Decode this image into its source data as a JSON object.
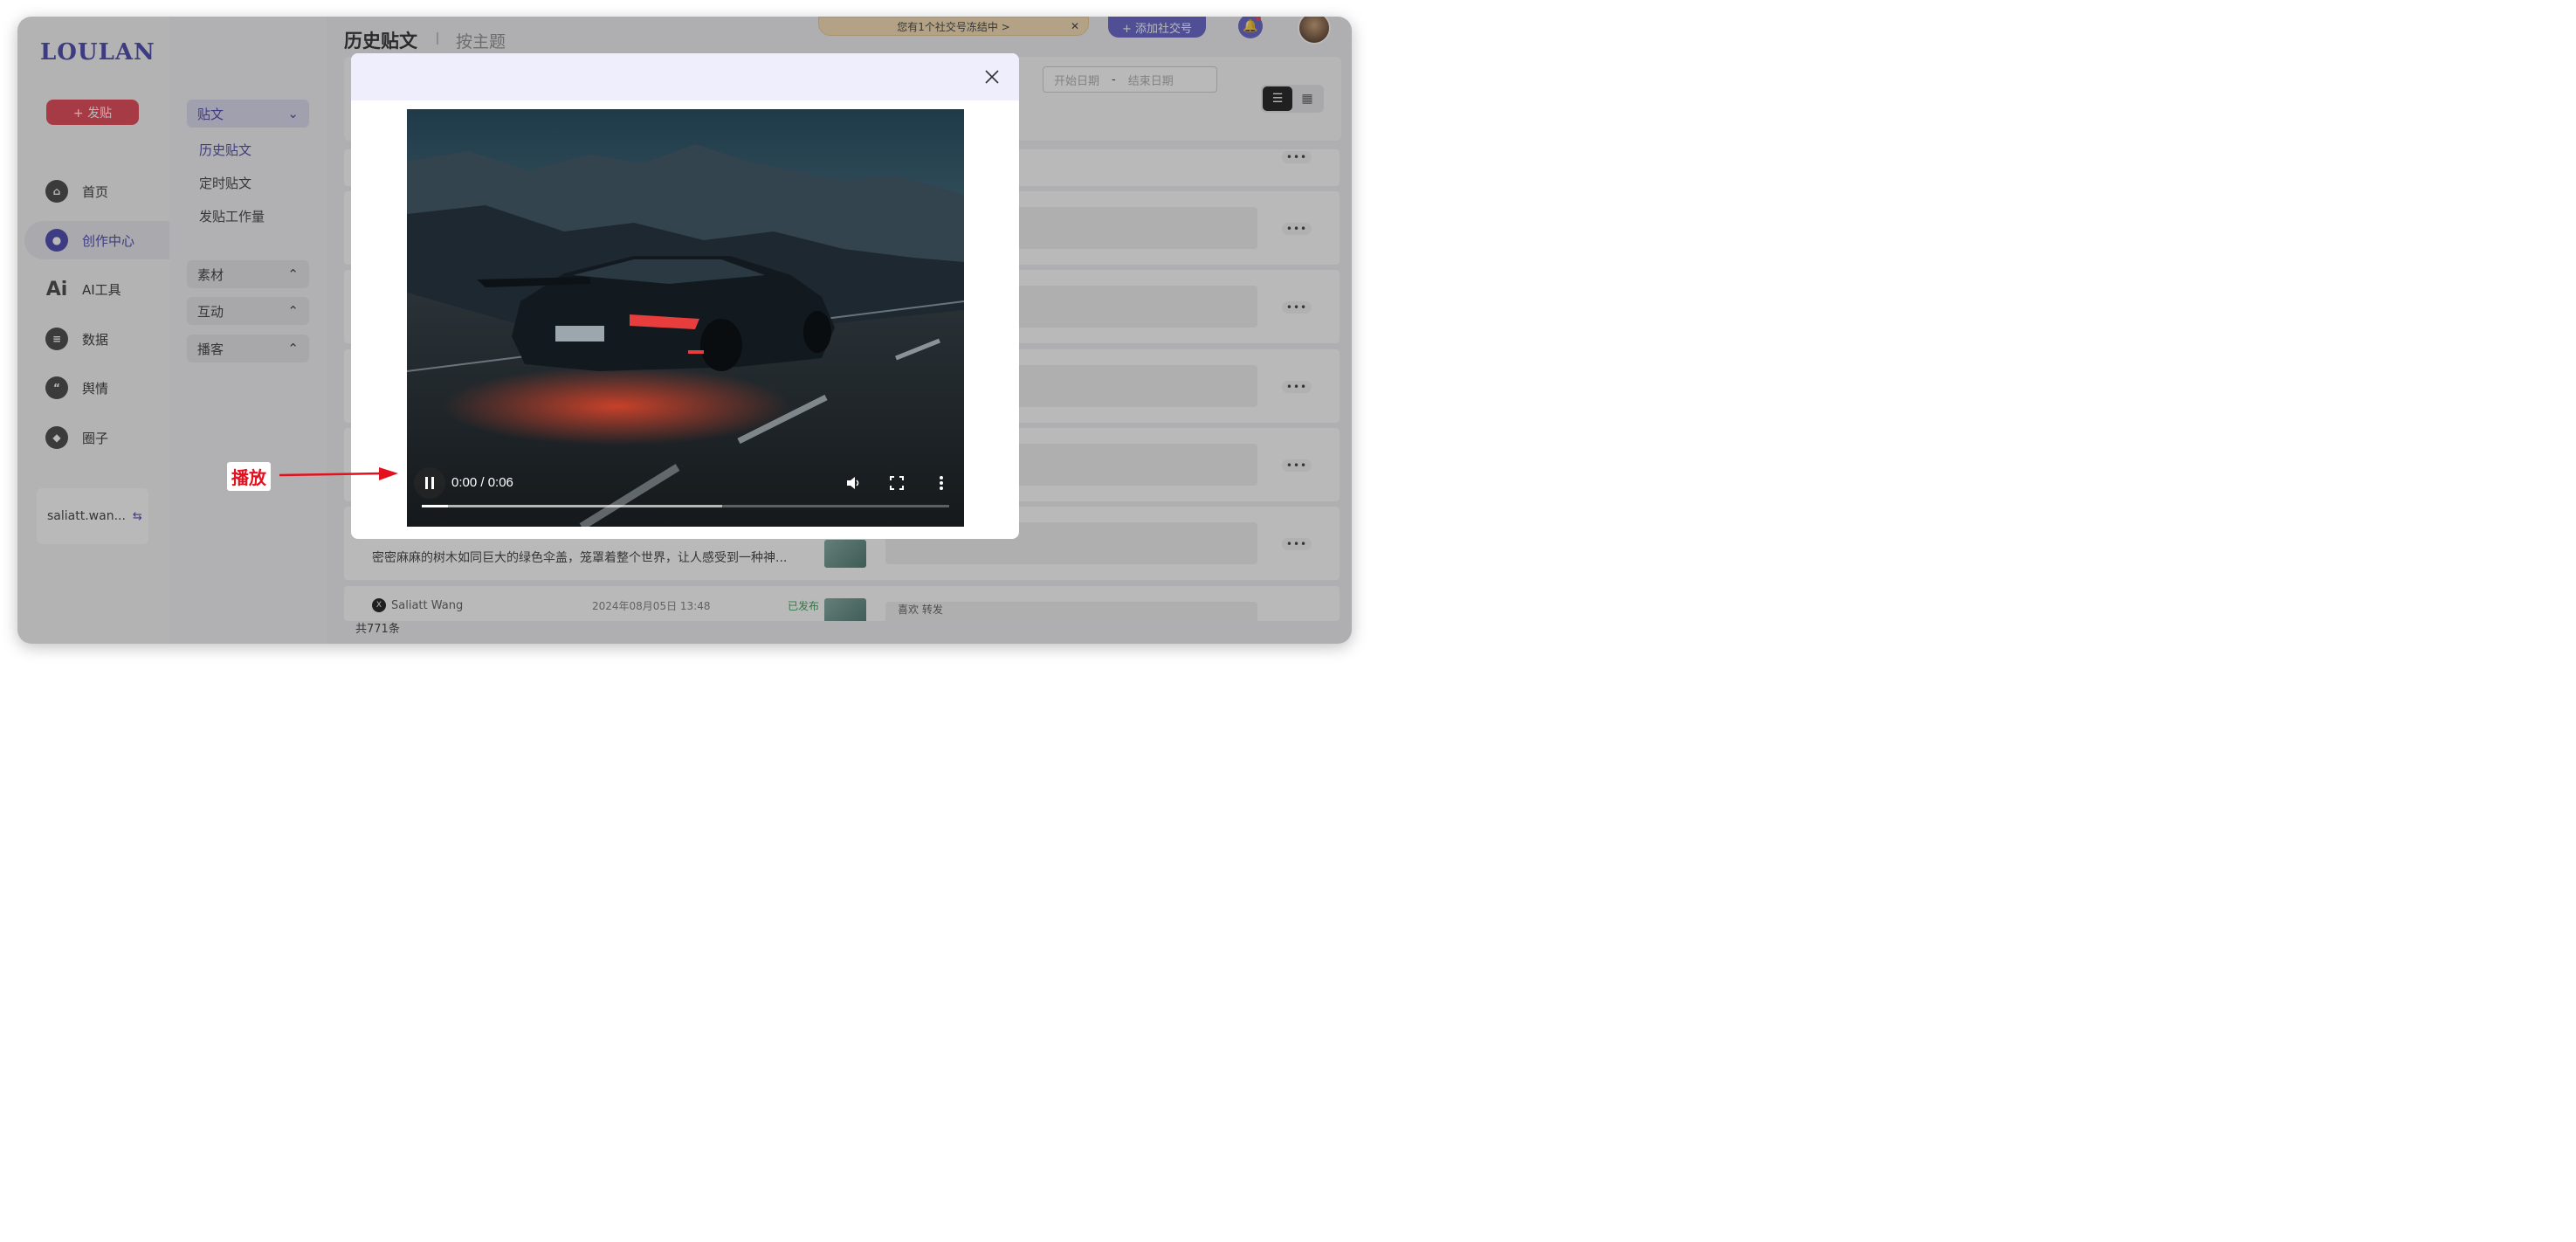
{
  "app": {
    "logo": "LOULAN",
    "post_button": "+ 发贴"
  },
  "sidebar": {
    "items": [
      {
        "label": "首页",
        "icon": "home-icon"
      },
      {
        "label": "创作中心",
        "icon": "palette-icon",
        "active": true
      },
      {
        "label": "AI工具",
        "icon": "ai-icon"
      },
      {
        "label": "数据",
        "icon": "database-icon"
      },
      {
        "label": "舆情",
        "icon": "quote-icon"
      },
      {
        "label": "圈子",
        "icon": "compass-icon"
      }
    ],
    "account": {
      "name": "saliatt.wan...",
      "icon": "swap-icon"
    }
  },
  "subnav": {
    "post_group": "贴文",
    "links": [
      "历史贴文",
      "定时贴文",
      "发贴工作量"
    ],
    "groups": [
      "素材",
      "互动",
      "播客"
    ]
  },
  "header": {
    "title": "历史贴文",
    "tab2": "按主题",
    "freeze_banner": "您有1个社交号冻结中 >",
    "add_social": "+ 添加社交号"
  },
  "filters": {
    "start_placeholder": "开始日期",
    "dash": "-",
    "end_placeholder": "结束日期"
  },
  "rows": [
    {
      "text": "密密麻麻的树木如同巨大的绿色伞盖，笼罩着整个世界，让人感受到一种神..."
    },
    {
      "author": "Saliatt Wang",
      "time": "2024年08月05日 13:48",
      "status": "已发布",
      "labels": "喜欢    转发"
    }
  ],
  "footer": {
    "total": "共771条"
  },
  "modal": {
    "video": {
      "time": "0:00 / 0:06",
      "state": "playing",
      "progress": 0.05,
      "buffered": 0.57
    }
  },
  "annotation": {
    "label": "播放",
    "color": "#e3101e"
  },
  "colors": {
    "accent": "#3d3aa8",
    "danger": "#e23b4c",
    "overlay": "rgba(60,60,60,0.36)"
  }
}
